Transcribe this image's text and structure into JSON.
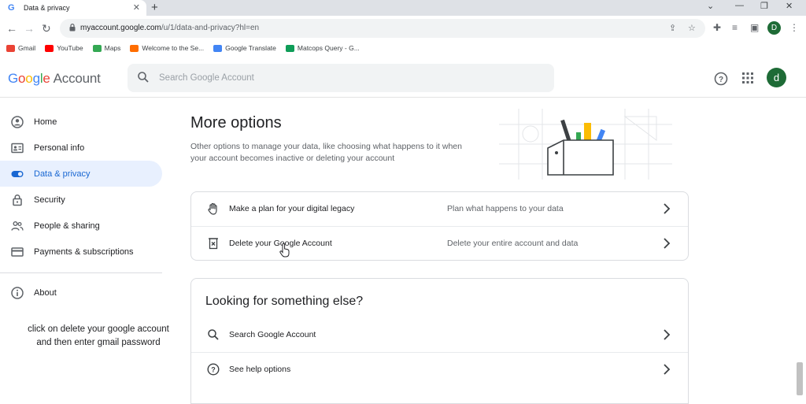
{
  "browser": {
    "tab_title": "Data & privacy",
    "new_tab_symbol": "+",
    "url_host": "myaccount.google.com",
    "url_path": "/u/1/data-and-privacy?hl=en",
    "profile_initial": "D"
  },
  "bookmarks": [
    {
      "label": "Gmail",
      "color": "#ea4335"
    },
    {
      "label": "YouTube",
      "color": "#ff0000"
    },
    {
      "label": "Maps",
      "color": "#34a853"
    },
    {
      "label": "Welcome to the Se...",
      "color": "#ff6d00"
    },
    {
      "label": "Google Translate",
      "color": "#4285f4"
    },
    {
      "label": "Matcops Query - G...",
      "color": "#0f9d58"
    }
  ],
  "header": {
    "logo_letters": [
      "G",
      "o",
      "o",
      "g",
      "l",
      "e"
    ],
    "logo_colors": [
      "#4285f4",
      "#ea4335",
      "#fbbc05",
      "#4285f4",
      "#34a853",
      "#ea4335"
    ],
    "logo_suffix": "Account",
    "search_placeholder": "Search Google Account",
    "avatar_initial": "d"
  },
  "sidebar": {
    "items": [
      {
        "label": "Home",
        "icon": "home-icon",
        "active": false
      },
      {
        "label": "Personal info",
        "icon": "id-card-icon",
        "active": false
      },
      {
        "label": "Data & privacy",
        "icon": "toggle-icon",
        "active": true
      },
      {
        "label": "Security",
        "icon": "lock-icon",
        "active": false
      },
      {
        "label": "People & sharing",
        "icon": "people-icon",
        "active": false
      },
      {
        "label": "Payments & subscriptions",
        "icon": "card-icon",
        "active": false
      }
    ],
    "about_label": "About"
  },
  "caption": {
    "line1": "click on delete your google account",
    "line2": "and then enter gmail password"
  },
  "main": {
    "title": "More options",
    "description": "Other options to manage your data, like choosing what happens to it when your account becomes inactive or deleting your account",
    "options": [
      {
        "label": "Make a plan for your digital legacy",
        "detail": "Plan what happens to your data",
        "icon": "hand-icon"
      },
      {
        "label": "Delete your Google Account",
        "detail": "Delete your entire account and data",
        "icon": "trash-icon"
      }
    ],
    "else_title": "Looking for something else?",
    "else_items": [
      {
        "label": "Search Google Account",
        "icon": "search-icon"
      },
      {
        "label": "See help options",
        "icon": "help-icon"
      }
    ]
  },
  "colors": {
    "accent": "#1967d2",
    "active_bg": "#e8f0fe",
    "avatar": "#1e6b36"
  }
}
